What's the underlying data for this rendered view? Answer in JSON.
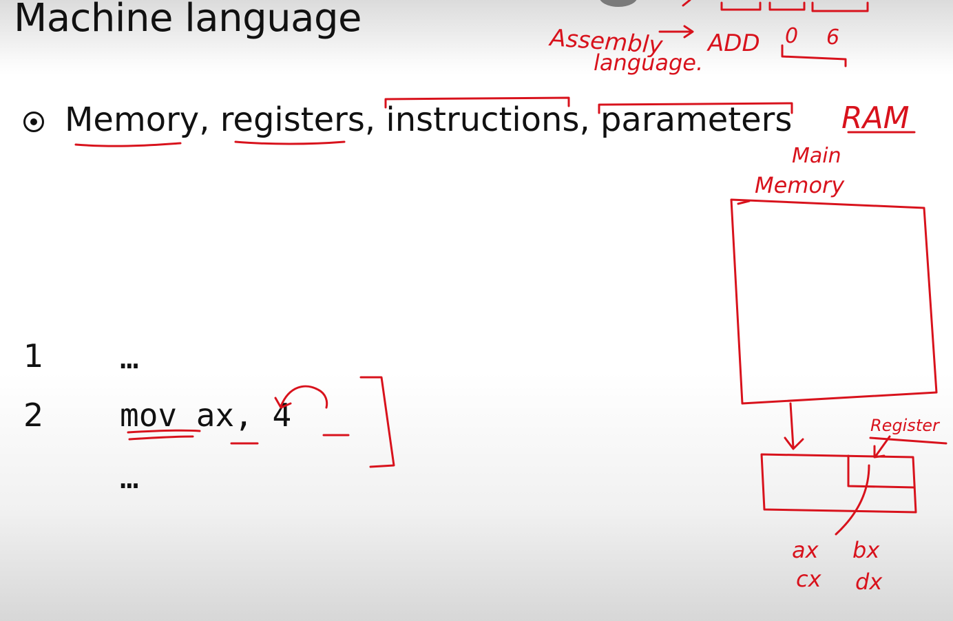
{
  "slide": {
    "title": "Machine language",
    "bullet": "Memory, registers, instructions, parameters"
  },
  "code_listing": [
    {
      "line": "1",
      "code": "…"
    },
    {
      "line": "2",
      "code": "mov ax, 4"
    },
    {
      "line": "",
      "code": "…"
    }
  ],
  "annotations": {
    "assembly": "Assembly",
    "language": "language.",
    "arrow_add": "ADD",
    "op_a": "0",
    "op_b": "6",
    "ram": "RAM",
    "main": "Main",
    "memory": "Memory",
    "register": "Register",
    "ax": "ax",
    "bx": "bx",
    "cx": "cx",
    "dx": "dx"
  },
  "colors": {
    "ink": "#d8121c",
    "text": "#111111"
  }
}
